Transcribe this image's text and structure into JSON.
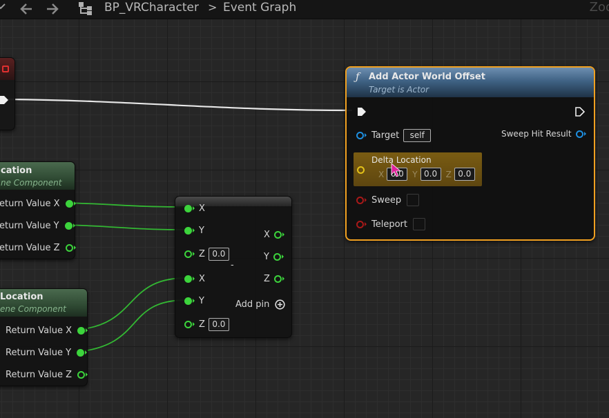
{
  "toolbar": {
    "breadcrumb_blueprint": "BP_VRCharacter",
    "breadcrumb_sep": ">",
    "breadcrumb_graph": "Event Graph",
    "zoom_label": "Zoo"
  },
  "node_left_top": {
    "title": "cation",
    "subtitle": "ne Component",
    "pins": [
      "eturn Value X",
      "eturn Value Y",
      "eturn Value Z"
    ]
  },
  "node_left_bottom": {
    "title": "Location",
    "subtitle": "ene Component",
    "pins": [
      "Return Value X",
      "Return Value Y",
      "Return Value Z"
    ]
  },
  "node_add": {
    "inputs_a": [
      "X",
      "Y",
      "Z"
    ],
    "inputs_b": [
      "X",
      "Y",
      "Z"
    ],
    "outputs": [
      "X",
      "Y",
      "Z"
    ],
    "z_value_a": "0.0",
    "z_value_b": "0.0",
    "minus_glyph": "-",
    "add_pin_label": "Add pin"
  },
  "node_offset": {
    "func_icon": "ƒ",
    "title": "Add Actor World Offset",
    "subtitle": "Target is Actor",
    "target_label": "Target",
    "target_value": "self",
    "sweep_hit_label": "Sweep Hit Result",
    "delta_label": "Delta Location",
    "delta_x_label": "X",
    "delta_x_value": "0.0",
    "delta_y_label": "Y",
    "delta_y_value": "0.0",
    "delta_z_label": "Z",
    "delta_z_value": "0.0",
    "sweep_label": "Sweep",
    "teleport_label": "Teleport"
  },
  "colors": {
    "float_pin": "#3cd43c",
    "object_pin": "#1e8fe0",
    "bool_pin": "#a91919",
    "struct_pin": "#e4c219",
    "selection_outline": "#f0a020",
    "cursor": "#e0209a"
  },
  "icons": [
    "collapse-chevron-icon",
    "back-arrow-icon",
    "forward-arrow-icon",
    "graph-hierarchy-icon",
    "exec-pin-icon",
    "add-circle-icon",
    "mouse-cursor-icon"
  ]
}
